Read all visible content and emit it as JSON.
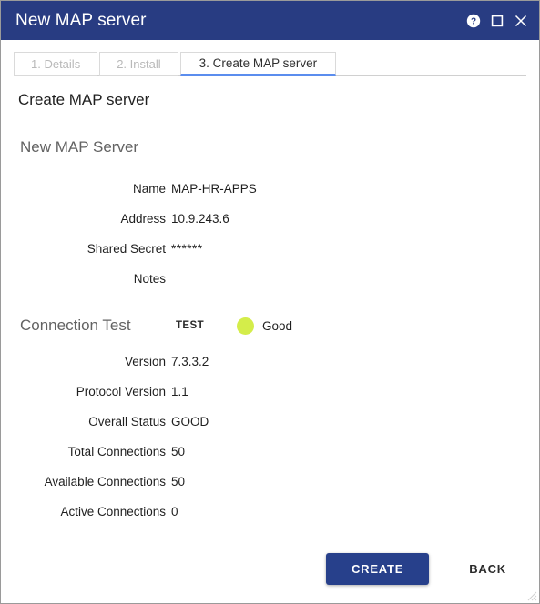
{
  "window": {
    "title": "New MAP server",
    "controls": [
      {
        "name": "help-icon",
        "label": "?"
      },
      {
        "name": "maximize-icon",
        "label": "□"
      },
      {
        "name": "close-icon",
        "label": "×"
      }
    ]
  },
  "tabs": [
    {
      "label": "1. Details",
      "state": "done"
    },
    {
      "label": "2. Install",
      "state": "done"
    },
    {
      "label": "3. Create MAP server",
      "state": "active"
    }
  ],
  "page": {
    "title": "Create MAP server",
    "section_title": "New MAP Server"
  },
  "server_fields": [
    {
      "label": "Name",
      "value": "MAP-HR-APPS"
    },
    {
      "label": "Address",
      "value": "10.9.243.6"
    },
    {
      "label": "Shared Secret",
      "value": "******"
    },
    {
      "label": "Notes",
      "value": ""
    }
  ],
  "connection_test": {
    "title": "Connection Test",
    "test_button": "TEST",
    "status_text": "Good",
    "status_color": "#d4ed4a"
  },
  "test_results": [
    {
      "label": "Version",
      "value": "7.3.3.2"
    },
    {
      "label": "Protocol Version",
      "value": "1.1"
    },
    {
      "label": "Overall Status",
      "value": "GOOD"
    },
    {
      "label": "Total Connections",
      "value": "50"
    },
    {
      "label": "Available Connections",
      "value": "50"
    },
    {
      "label": "Active Connections",
      "value": "0"
    }
  ],
  "footer": {
    "create_label": "CREATE",
    "back_label": "BACK"
  },
  "colors": {
    "titlebar": "#283c82",
    "primary_button": "#27408b",
    "active_tab_underline": "#5b8dee",
    "status_good": "#d4ed4a"
  }
}
